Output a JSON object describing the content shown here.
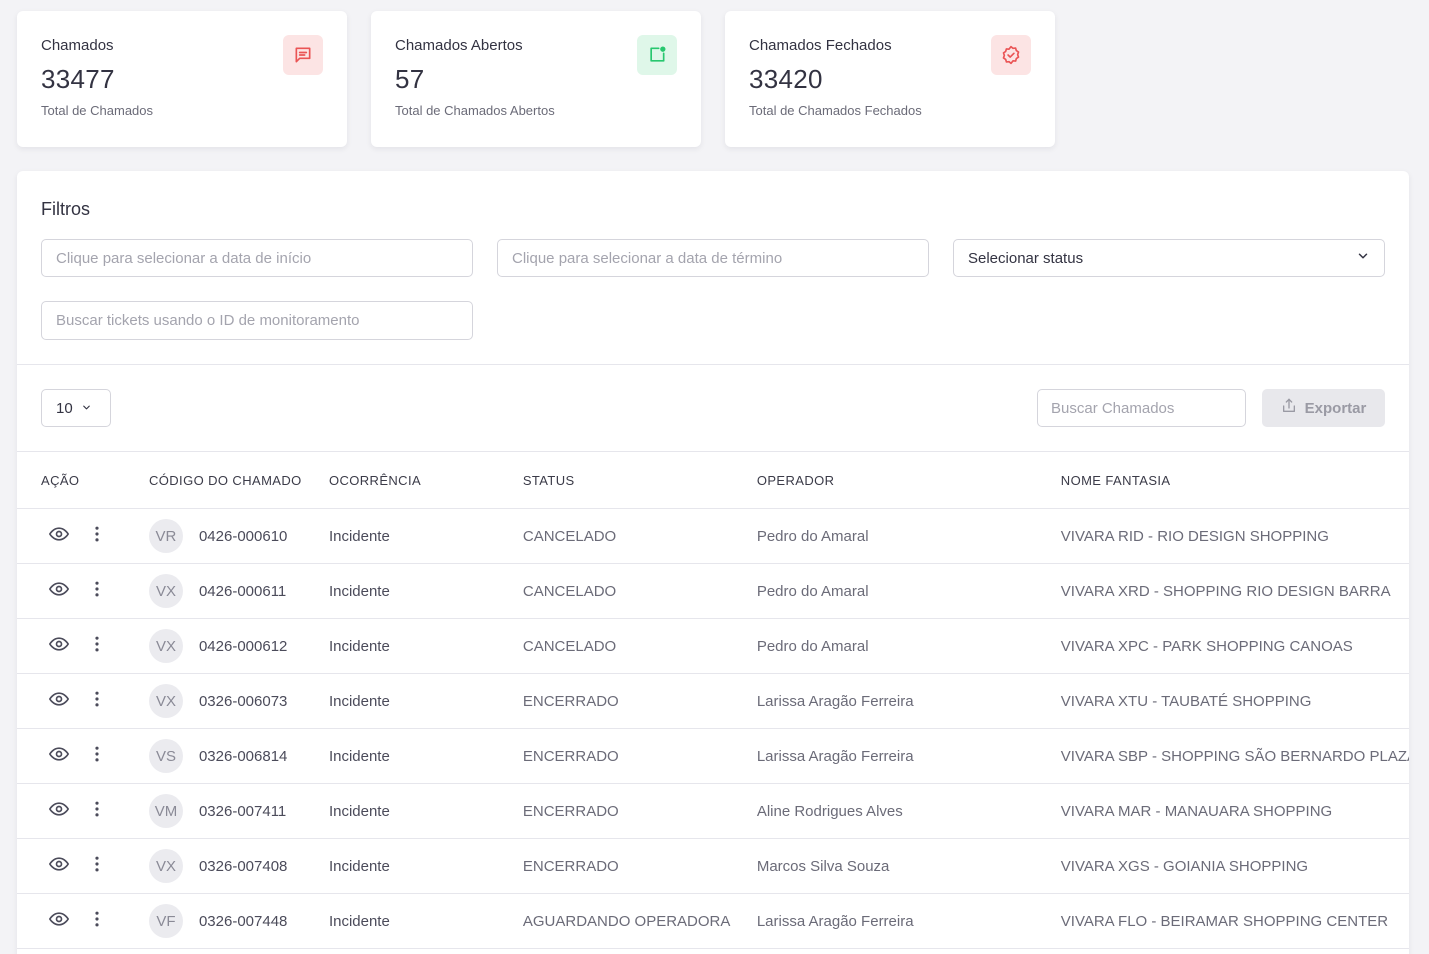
{
  "cards": [
    {
      "title": "Chamados",
      "value": "33477",
      "sub": "Total de Chamados",
      "icon": "message-square-icon",
      "color": "#ea5455",
      "bg": "#fce4e4"
    },
    {
      "title": "Chamados Abertos",
      "value": "57",
      "sub": "Total de Chamados Abertos",
      "icon": "notification-square-icon",
      "color": "#28c76f",
      "bg": "#dff7e9"
    },
    {
      "title": "Chamados Fechados",
      "value": "33420",
      "sub": "Total de Chamados Fechados",
      "icon": "badge-check-icon",
      "color": "#ea5455",
      "bg": "#fce4e4"
    }
  ],
  "filters": {
    "title": "Filtros",
    "start_date_placeholder": "Clique para selecionar a data de início",
    "end_date_placeholder": "Clique para selecionar a data de término",
    "status_value": "Selecionar status",
    "monitor_search_placeholder": "Buscar tickets usando o ID de monitoramento"
  },
  "toolbar": {
    "page_size": "10",
    "search_placeholder": "Buscar Chamados",
    "export_label": "Exportar"
  },
  "table": {
    "columns": [
      "AÇÃO",
      "CÓDIGO DO CHAMADO",
      "OCORRÊNCIA",
      "STATUS",
      "OPERADOR",
      "NOME FANTASIA"
    ],
    "rows": [
      {
        "initials": "VR",
        "code": "0426-000610",
        "occurrence": "Incidente",
        "status": "CANCELADO",
        "operator": "Pedro do Amaral",
        "store": "VIVARA RID - RIO DESIGN SHOPPING"
      },
      {
        "initials": "VX",
        "code": "0426-000611",
        "occurrence": "Incidente",
        "status": "CANCELADO",
        "operator": "Pedro do Amaral",
        "store": "VIVARA XRD - SHOPPING RIO DESIGN BARRA"
      },
      {
        "initials": "VX",
        "code": "0426-000612",
        "occurrence": "Incidente",
        "status": "CANCELADO",
        "operator": "Pedro do Amaral",
        "store": "VIVARA XPC - PARK SHOPPING CANOAS"
      },
      {
        "initials": "VX",
        "code": "0326-006073",
        "occurrence": "Incidente",
        "status": "ENCERRADO",
        "operator": "Larissa Aragão Ferreira",
        "store": "VIVARA XTU - TAUBATÉ SHOPPING"
      },
      {
        "initials": "VS",
        "code": "0326-006814",
        "occurrence": "Incidente",
        "status": "ENCERRADO",
        "operator": "Larissa Aragão Ferreira",
        "store": "VIVARA SBP - SHOPPING SÃO BERNARDO PLAZA"
      },
      {
        "initials": "VM",
        "code": "0326-007411",
        "occurrence": "Incidente",
        "status": "ENCERRADO",
        "operator": "Aline Rodrigues Alves",
        "store": "VIVARA MAR - MANAUARA SHOPPING"
      },
      {
        "initials": "VX",
        "code": "0326-007408",
        "occurrence": "Incidente",
        "status": "ENCERRADO",
        "operator": "Marcos Silva Souza",
        "store": "VIVARA XGS - GOIANIA SHOPPING"
      },
      {
        "initials": "VF",
        "code": "0326-007448",
        "occurrence": "Incidente",
        "status": "AGUARDANDO OPERADORA",
        "operator": "Larissa Aragão Ferreira",
        "store": "VIVARA FLO - BEIRAMAR SHOPPING CENTER"
      }
    ]
  }
}
